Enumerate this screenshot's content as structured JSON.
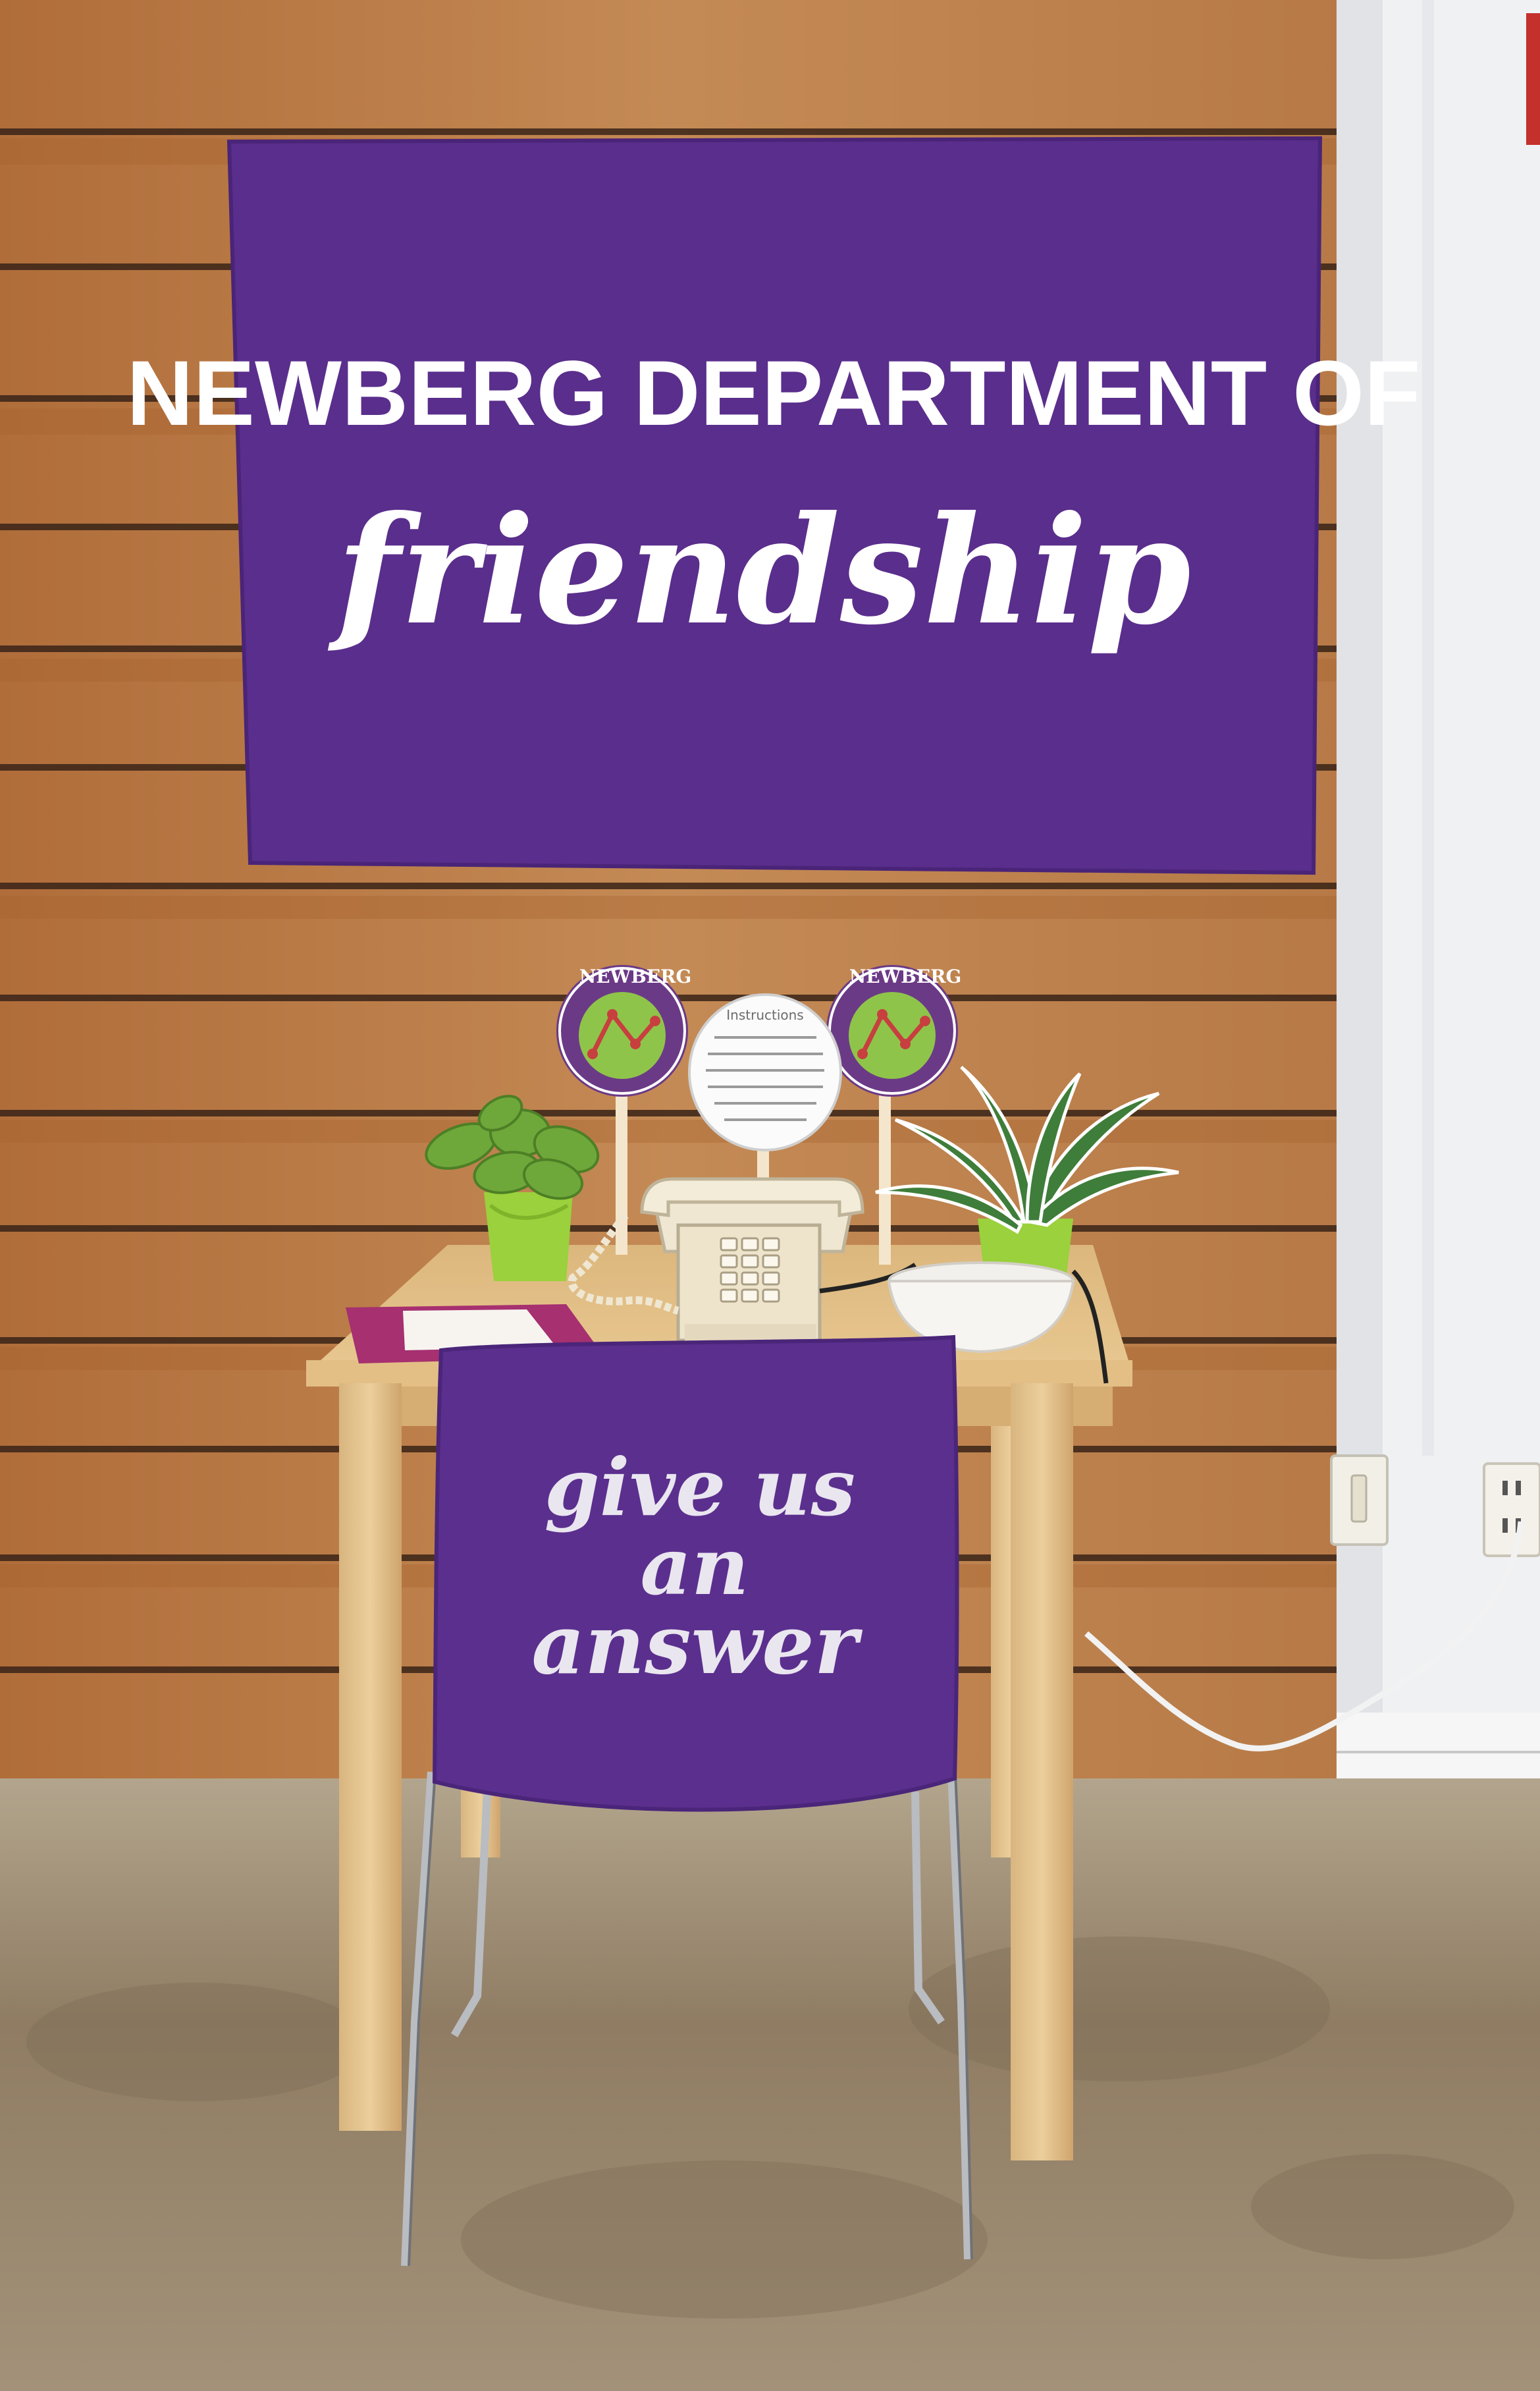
{
  "banner": {
    "line1": "NEWBERG DEPARTMENT OF",
    "line2": "friendship",
    "color": "#5a2e8c"
  },
  "chair_cover": {
    "line1": "give us",
    "line2": "an",
    "line3": "answer",
    "color": "#5b2f8e"
  },
  "seals": {
    "top_word": "NEWBERG"
  },
  "instruction_card": {
    "heading": "Instructions"
  },
  "colors": {
    "wood": "#b97a45",
    "wall": "#f0f1f3",
    "floor": "#9a8870",
    "plant_pot": "#9ad13c",
    "seal_ring": "#6b3a86",
    "seal_center": "#8fc44a"
  }
}
